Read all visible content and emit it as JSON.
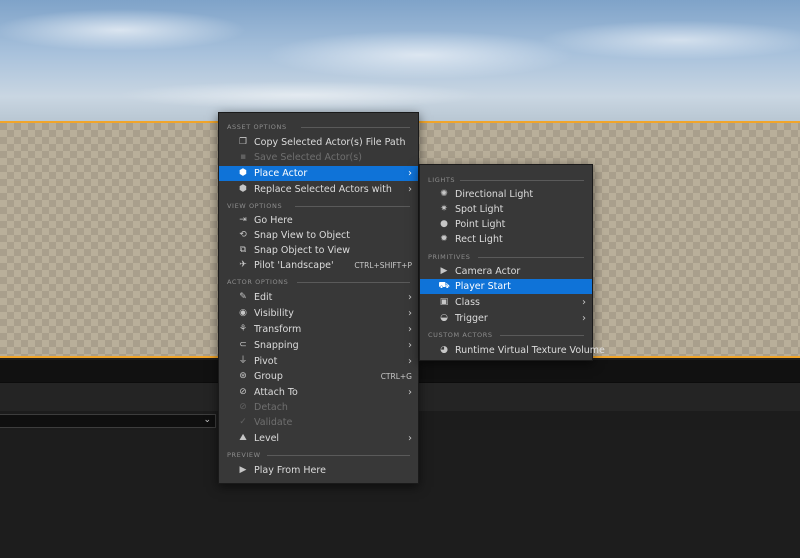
{
  "main_menu": {
    "sections": [
      {
        "header": "ASSET OPTIONS",
        "items": [
          {
            "label": "Copy Selected Actor(s) File Path",
            "icon": "copy-icon",
            "disabled": false
          },
          {
            "label": "Save Selected Actor(s)",
            "icon": "save-icon",
            "disabled": true
          },
          {
            "label": "Place Actor",
            "icon": "place-actor-icon",
            "submenu": true,
            "highlighted": true
          },
          {
            "label": "Replace Selected Actors with",
            "icon": "replace-icon",
            "submenu": true
          }
        ]
      },
      {
        "header": "VIEW OPTIONS",
        "items": [
          {
            "label": "Go Here",
            "icon": "go-here-icon"
          },
          {
            "label": "Snap View to Object",
            "icon": "snap-view-icon"
          },
          {
            "label": "Snap Object to View",
            "icon": "snap-object-icon"
          },
          {
            "label": "Pilot 'Landscape'",
            "icon": "pilot-icon",
            "shortcut": "CTRL+SHIFT+P"
          }
        ]
      },
      {
        "header": "ACTOR OPTIONS",
        "items": [
          {
            "label": "Edit",
            "icon": "edit-icon",
            "submenu": true
          },
          {
            "label": "Visibility",
            "icon": "eye-icon",
            "submenu": true
          },
          {
            "label": "Transform",
            "icon": "transform-icon",
            "submenu": true
          },
          {
            "label": "Snapping",
            "icon": "snapping-icon",
            "submenu": true
          },
          {
            "label": "Pivot",
            "icon": "pivot-icon",
            "submenu": true
          },
          {
            "label": "Group",
            "icon": "group-icon",
            "shortcut": "CTRL+G"
          },
          {
            "label": "Attach To",
            "icon": "attach-icon",
            "submenu": true
          },
          {
            "label": "Detach",
            "icon": "detach-icon",
            "disabled": true
          },
          {
            "label": "Validate",
            "icon": "validate-icon",
            "disabled": true
          },
          {
            "label": "Level",
            "icon": "level-icon",
            "submenu": true
          }
        ]
      },
      {
        "header": "PREVIEW",
        "items": [
          {
            "label": "Play From Here",
            "icon": "play-icon"
          }
        ]
      }
    ]
  },
  "place_actor_menu": {
    "sections": [
      {
        "header": "LIGHTS",
        "items": [
          {
            "label": "Directional Light",
            "icon": "directional-light-icon"
          },
          {
            "label": "Spot Light",
            "icon": "spot-light-icon"
          },
          {
            "label": "Point Light",
            "icon": "point-light-icon"
          },
          {
            "label": "Rect Light",
            "icon": "rect-light-icon"
          }
        ]
      },
      {
        "header": "PRIMITIVES",
        "items": [
          {
            "label": "Camera Actor",
            "icon": "camera-icon"
          },
          {
            "label": "Player Start",
            "icon": "player-start-icon",
            "highlighted": true
          },
          {
            "label": "Class",
            "icon": "class-icon",
            "submenu": true
          },
          {
            "label": "Trigger",
            "icon": "trigger-icon",
            "submenu": true
          }
        ]
      },
      {
        "header": "CUSTOM ACTORS",
        "items": [
          {
            "label": "Runtime Virtual Texture Volume",
            "icon": "virtual-texture-icon"
          }
        ]
      }
    ]
  },
  "colors": {
    "highlight": "#0f73d8",
    "menu_bg": "#383838",
    "selection_outline": "#f1a52a"
  }
}
